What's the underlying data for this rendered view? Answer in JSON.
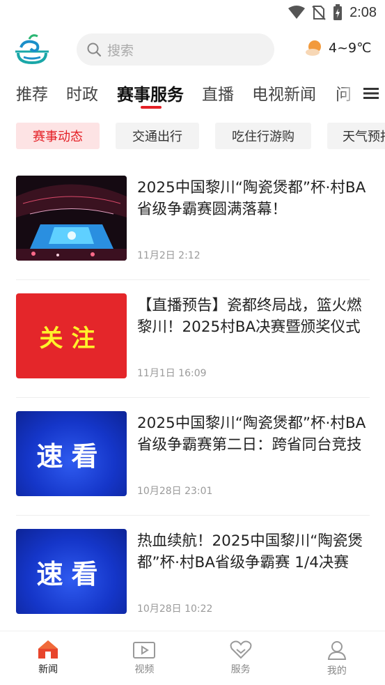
{
  "status_bar": {
    "time": "2:08"
  },
  "header": {
    "search": {
      "placeholder": "搜索"
    },
    "weather": {
      "temp": "4~9℃",
      "icon": "partly-sunny-icon"
    }
  },
  "channel_tabs": [
    {
      "label": "推荐",
      "active": false
    },
    {
      "label": "时政",
      "active": false
    },
    {
      "label": "赛事服务",
      "active": true
    },
    {
      "label": "直播",
      "active": false
    },
    {
      "label": "电视新闻",
      "active": false
    },
    {
      "label": "问",
      "active": false
    }
  ],
  "sub_tabs": [
    {
      "label": "赛事动态",
      "active": true
    },
    {
      "label": "交通出行",
      "active": false
    },
    {
      "label": "吃住行游购",
      "active": false
    },
    {
      "label": "天气预报",
      "active": false
    }
  ],
  "news": [
    {
      "title": "2025中国黎川“陶瓷煲都”杯·村BA省级争霸赛圆满落幕！",
      "time": "11月2日 2:12",
      "thumb": "arena-photo"
    },
    {
      "title": "【直播预告】瓷都终局战，篮火燃黎川！2025村BA决赛暨颁奖仪式",
      "time": "11月1日 16:09",
      "thumb": "关注"
    },
    {
      "title": "2025中国黎川“陶瓷煲都”杯·村BA省级争霸赛第二日：跨省同台竞技",
      "time": "10月28日 23:01",
      "thumb": "速看"
    },
    {
      "title": "热血续航！2025中国黎川“陶瓷煲都”杯·村BA省级争霸赛 1/4决赛",
      "time": "10月28日 10:22",
      "thumb": "速看"
    }
  ],
  "bottom_nav": [
    {
      "label": "新闻",
      "icon": "home-icon",
      "active": true
    },
    {
      "label": "视频",
      "icon": "video-icon",
      "active": false
    },
    {
      "label": "服务",
      "icon": "heart-icon",
      "active": false
    },
    {
      "label": "我的",
      "icon": "user-icon",
      "active": false
    }
  ],
  "colors": {
    "accent": "#e41f25",
    "chip_active_bg": "#fde3e4"
  }
}
